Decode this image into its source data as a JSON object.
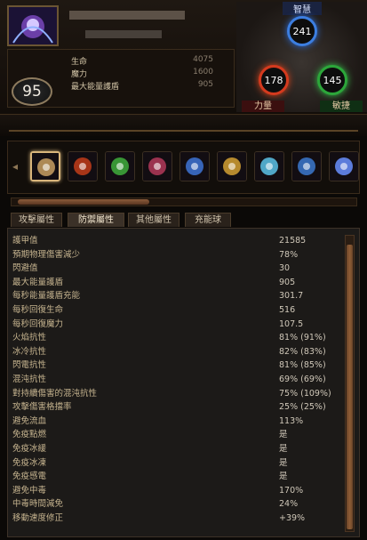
{
  "character": {
    "level": "95",
    "stats": [
      {
        "label": "生命",
        "value": "4075"
      },
      {
        "label": "魔力",
        "value": "1600"
      },
      {
        "label": "最大能量護盾",
        "value": "905"
      }
    ]
  },
  "attributes": {
    "intelligence": {
      "label": "智慧",
      "value": "241"
    },
    "strength": {
      "label": "力量",
      "value": "178"
    },
    "dexterity": {
      "label": "敏捷",
      "value": "145"
    }
  },
  "skills": [
    {
      "icon": "staff-weapon-icon",
      "color": "#c9a063",
      "selected": true
    },
    {
      "icon": "flame-figure-icon",
      "color": "#c23d1a"
    },
    {
      "icon": "green-summon-icon",
      "color": "#3fae3c"
    },
    {
      "icon": "red-blue-orb-icon",
      "color": "#b43a5a"
    },
    {
      "icon": "blue-flame-ring-icon",
      "color": "#3e74d6"
    },
    {
      "icon": "lightning-skull-icon",
      "color": "#d3a134"
    },
    {
      "icon": "ice-spirit-icon",
      "color": "#5cc3e8"
    },
    {
      "icon": "blue-hand-icon",
      "color": "#3c79cf"
    },
    {
      "icon": "arcane-burst-icon",
      "color": "#6a90ff"
    }
  ],
  "tabs": [
    {
      "label": "攻擊屬性",
      "active": false
    },
    {
      "label": "防禦屬性",
      "active": true
    },
    {
      "label": "其他屬性",
      "active": false
    },
    {
      "label": "充能球",
      "active": false
    }
  ],
  "defense_rows": [
    {
      "name": "護甲值",
      "value": "21585"
    },
    {
      "name": "預期物理傷害減少",
      "value": "78%"
    },
    {
      "name": "閃避值",
      "value": "30"
    },
    {
      "name": "最大能量護盾",
      "value": "905"
    },
    {
      "name": "每秒能量護盾充能",
      "value": "301.7"
    },
    {
      "name": "每秒回復生命",
      "value": "516"
    },
    {
      "name": "每秒回復魔力",
      "value": "107.5"
    },
    {
      "name": "火焰抗性",
      "value": "81% (91%)"
    },
    {
      "name": "冰冷抗性",
      "value": "82% (83%)"
    },
    {
      "name": "閃電抗性",
      "value": "81% (85%)"
    },
    {
      "name": "混沌抗性",
      "value": "69% (69%)"
    },
    {
      "name": "對持續傷害的混沌抗性",
      "value": "75% (109%)"
    },
    {
      "name": "攻擊傷害格擋率",
      "value": "25% (25%)"
    },
    {
      "name": "避免流血",
      "value": "113%"
    },
    {
      "name": "免疫點燃",
      "value": "是"
    },
    {
      "name": "免疫冰緩",
      "value": "是"
    },
    {
      "name": "免疫冰凍",
      "value": "是"
    },
    {
      "name": "免疫感電",
      "value": "是"
    },
    {
      "name": "避免中毒",
      "value": "170%"
    },
    {
      "name": "中毒時間減免",
      "value": "24%"
    },
    {
      "name": "移動速度修正",
      "value": "+39%"
    }
  ]
}
